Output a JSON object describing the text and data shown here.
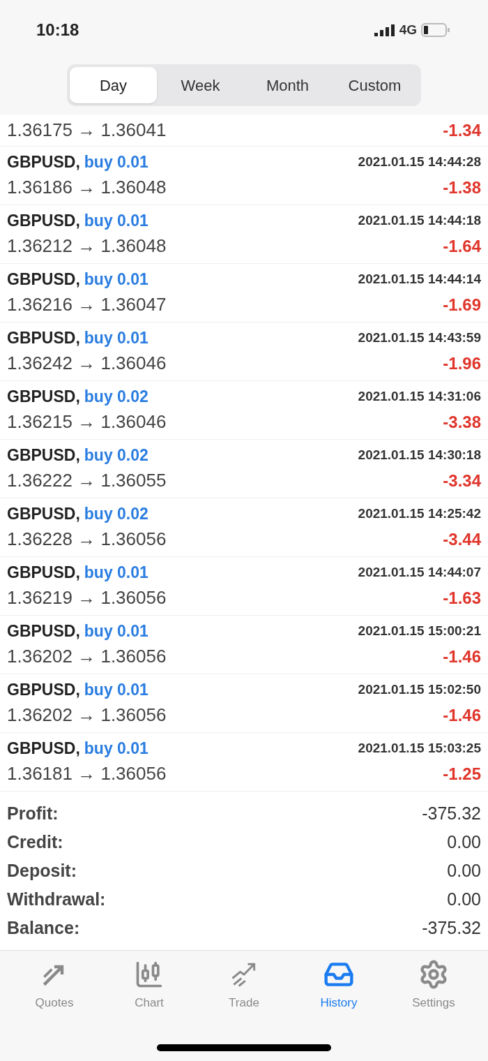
{
  "status_bar": {
    "time": "10:18",
    "network": "4G"
  },
  "periods": [
    {
      "label": "Day",
      "selected": true
    },
    {
      "label": "Week",
      "selected": false
    },
    {
      "label": "Month",
      "selected": false
    },
    {
      "label": "Custom",
      "selected": false
    }
  ],
  "trades": [
    {
      "prices": "1.36175 → 1.36041",
      "profit": "-1.34"
    },
    {
      "symbol": "GBPUSD,",
      "order": "buy 0.01",
      "time": "2021.01.15 14:44:28",
      "prices": "1.36186 → 1.36048",
      "profit": "-1.38"
    },
    {
      "symbol": "GBPUSD,",
      "order": "buy 0.01",
      "time": "2021.01.15 14:44:18",
      "prices": "1.36212 → 1.36048",
      "profit": "-1.64"
    },
    {
      "symbol": "GBPUSD,",
      "order": "buy 0.01",
      "time": "2021.01.15 14:44:14",
      "prices": "1.36216 → 1.36047",
      "profit": "-1.69"
    },
    {
      "symbol": "GBPUSD,",
      "order": "buy 0.01",
      "time": "2021.01.15 14:43:59",
      "prices": "1.36242 → 1.36046",
      "profit": "-1.96"
    },
    {
      "symbol": "GBPUSD,",
      "order": "buy 0.02",
      "time": "2021.01.15 14:31:06",
      "prices": "1.36215 → 1.36046",
      "profit": "-3.38"
    },
    {
      "symbol": "GBPUSD,",
      "order": "buy 0.02",
      "time": "2021.01.15 14:30:18",
      "prices": "1.36222 → 1.36055",
      "profit": "-3.34"
    },
    {
      "symbol": "GBPUSD,",
      "order": "buy 0.02",
      "time": "2021.01.15 14:25:42",
      "prices": "1.36228 → 1.36056",
      "profit": "-3.44"
    },
    {
      "symbol": "GBPUSD,",
      "order": "buy 0.01",
      "time": "2021.01.15 14:44:07",
      "prices": "1.36219 → 1.36056",
      "profit": "-1.63"
    },
    {
      "symbol": "GBPUSD,",
      "order": "buy 0.01",
      "time": "2021.01.15 15:00:21",
      "prices": "1.36202 → 1.36056",
      "profit": "-1.46"
    },
    {
      "symbol": "GBPUSD,",
      "order": "buy 0.01",
      "time": "2021.01.15 15:02:50",
      "prices": "1.36202 → 1.36056",
      "profit": "-1.46"
    },
    {
      "symbol": "GBPUSD,",
      "order": "buy 0.01",
      "time": "2021.01.15 15:03:25",
      "prices": "1.36181 → 1.36056",
      "profit": "-1.25"
    }
  ],
  "summary": [
    {
      "label": "Profit:",
      "value": "-375.32"
    },
    {
      "label": "Credit:",
      "value": "0.00"
    },
    {
      "label": "Deposit:",
      "value": "0.00"
    },
    {
      "label": "Withdrawal:",
      "value": "0.00"
    },
    {
      "label": "Balance:",
      "value": "-375.32"
    }
  ],
  "tab_bar": [
    {
      "kind": "quotes",
      "label": "Quotes",
      "selected": false
    },
    {
      "kind": "chart",
      "label": "Chart",
      "selected": false
    },
    {
      "kind": "trade",
      "label": "Trade",
      "selected": false
    },
    {
      "kind": "history",
      "label": "History",
      "selected": true
    },
    {
      "kind": "settings",
      "label": "Settings",
      "selected": false
    }
  ]
}
